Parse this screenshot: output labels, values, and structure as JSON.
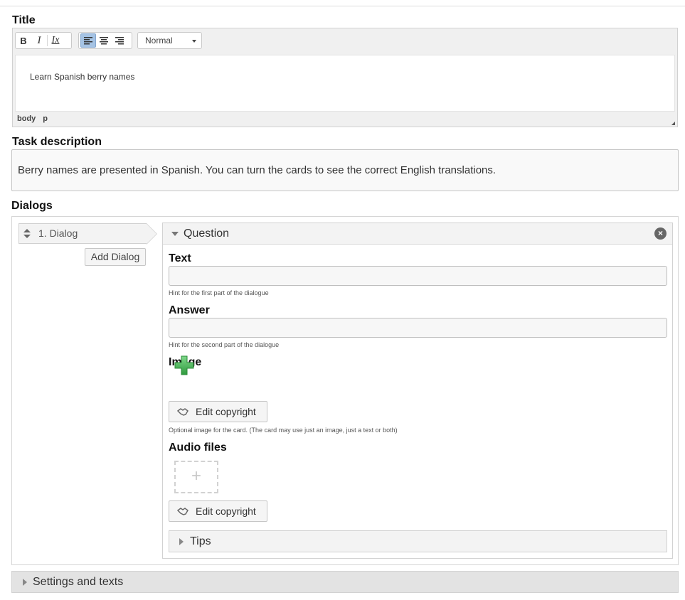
{
  "title_section": {
    "label": "Title",
    "toolbar": {
      "bold": "B",
      "italic": "I",
      "clear_format": "Ix",
      "format_value": "Normal"
    },
    "value": "Learn Spanish berry names",
    "path": [
      "body",
      "p"
    ]
  },
  "task_description": {
    "label": "Task description",
    "value": "Berry names are presented in Spanish. You can turn the cards to see the correct English translations."
  },
  "dialogs": {
    "label": "Dialogs",
    "items": [
      {
        "label": "1. Dialog"
      }
    ],
    "add_label": "Add Dialog",
    "question": {
      "title": "Question",
      "text": {
        "label": "Text",
        "value": "",
        "hint": "Hint for the first part of the dialogue"
      },
      "answer": {
        "label": "Answer",
        "value": "",
        "hint": "Hint for the second part of the dialogue"
      },
      "image": {
        "label": "Image",
        "edit_copyright": "Edit copyright",
        "hint": "Optional image for the card. (The card may use just an image, just a text or both)"
      },
      "audio": {
        "label": "Audio files",
        "edit_copyright": "Edit copyright",
        "add_glyph": "+"
      },
      "tips_label": "Tips"
    }
  },
  "settings": {
    "label": "Settings and texts"
  },
  "icons": {
    "close": "close-icon",
    "add": "green-plus-icon",
    "handshake": "handshake-icon"
  },
  "colors": {
    "active_align": "#a5c3e4",
    "plus_green": "#3ea84c"
  }
}
